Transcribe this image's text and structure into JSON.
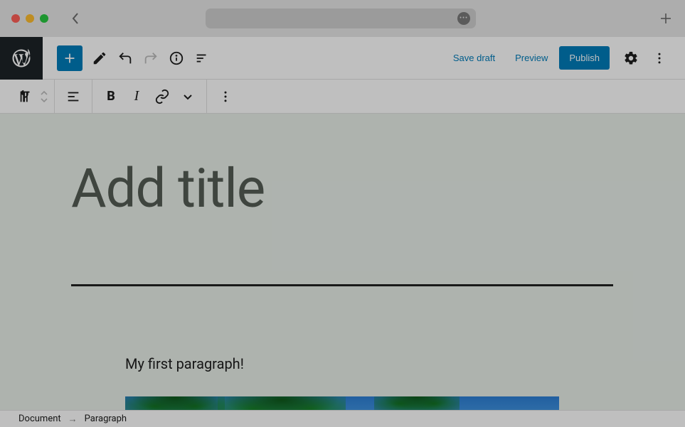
{
  "topbar": {
    "save_draft": "Save draft",
    "preview": "Preview",
    "publish": "Publish"
  },
  "editor": {
    "title_placeholder": "Add title",
    "paragraph_text": "My first paragraph!"
  },
  "breadcrumb": {
    "root": "Document",
    "current": "Paragraph"
  }
}
